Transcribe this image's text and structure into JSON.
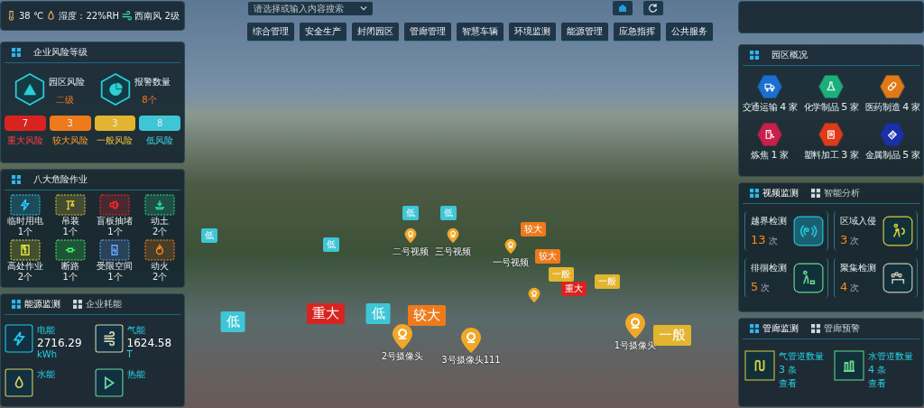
{
  "weather": [
    {
      "kind": "temperature",
      "text": "38 ℃"
    },
    {
      "kind": "humidity",
      "text": "湿度：22%RH"
    },
    {
      "kind": "wind",
      "text": "西南风 2级"
    }
  ],
  "search": {
    "placeholder": "请选择或输入内容搜索"
  },
  "nav": [
    "综合管理",
    "安全生产",
    "封闭园区",
    "管廊管理",
    "智慧车辆",
    "环境监测",
    "能源管理",
    "应急指挥",
    "公共服务"
  ],
  "risk_panel": {
    "title": "企业风险等级",
    "stats": [
      {
        "kind": "risk",
        "label": "园区风险",
        "value": "二级"
      },
      {
        "kind": "alarm",
        "label": "报警数量",
        "value": "8个"
      }
    ],
    "levels": [
      {
        "kind": "major",
        "count": "7",
        "label": "重大风险"
      },
      {
        "kind": "large",
        "count": "3",
        "label": "较大风险"
      },
      {
        "kind": "general",
        "count": "3",
        "label": "一般风险"
      },
      {
        "kind": "low",
        "count": "8",
        "label": "低风险"
      }
    ]
  },
  "hazard_panel": {
    "title": "八大危险作业",
    "items": [
      {
        "kind": "power",
        "label": "临时用电",
        "count": "1个"
      },
      {
        "kind": "crane",
        "label": "吊装",
        "count": "1个"
      },
      {
        "kind": "blind",
        "label": "盲板抽堵",
        "count": "1个"
      },
      {
        "kind": "earth",
        "label": "动土",
        "count": "2个"
      },
      {
        "kind": "height",
        "label": "高处作业",
        "count": "2个"
      },
      {
        "kind": "road",
        "label": "断路",
        "count": "1个"
      },
      {
        "kind": "confined",
        "label": "受限空间",
        "count": "1个"
      },
      {
        "kind": "fire",
        "label": "动火",
        "count": "2个"
      }
    ]
  },
  "energy_panel": {
    "tabs": [
      {
        "label": "能源监测",
        "selected": true
      },
      {
        "label": "企业耗能",
        "selected": false
      }
    ],
    "cards": [
      {
        "kind": "electric",
        "label": "电能",
        "value": "2716.29",
        "unit": "kWh"
      },
      {
        "kind": "gas",
        "label": "气能",
        "value": "1624.58",
        "unit": "T"
      },
      {
        "kind": "water",
        "label": "水能"
      },
      {
        "kind": "heat",
        "label": "热能"
      }
    ]
  },
  "park_panel": {
    "title": "园区概况",
    "items": [
      {
        "kind": "transport",
        "label": "交通运输",
        "count": "4",
        "unit": "家"
      },
      {
        "kind": "chemical",
        "label": "化学制品",
        "count": "5",
        "unit": "家"
      },
      {
        "kind": "medicine",
        "label": "医药制造",
        "count": "4",
        "unit": "家"
      },
      {
        "kind": "coking",
        "label": "炼焦",
        "count": "1",
        "unit": "家"
      },
      {
        "kind": "plastic",
        "label": "塑料加工",
        "count": "3",
        "unit": "家"
      },
      {
        "kind": "metal",
        "label": "金属制品",
        "count": "5",
        "unit": "家"
      }
    ]
  },
  "video_panel": {
    "tabs": [
      {
        "label": "视频监测",
        "selected": true
      },
      {
        "label": "智能分析",
        "selected": false
      }
    ],
    "items": [
      {
        "kind": "boundary",
        "label": "越界检测",
        "count": "13",
        "unit": "次"
      },
      {
        "kind": "intrusion",
        "label": "区域入侵",
        "count": "3",
        "unit": "次"
      },
      {
        "kind": "loiter",
        "label": "徘徊检测",
        "count": "5",
        "unit": "次"
      },
      {
        "kind": "gather",
        "label": "聚集检测",
        "count": "4",
        "unit": "次"
      }
    ]
  },
  "pipe_panel": {
    "tabs": [
      {
        "label": "管廊监测",
        "selected": true
      },
      {
        "label": "管廊预警",
        "selected": false
      }
    ],
    "items": [
      {
        "kind": "gas",
        "label": "气管道数量",
        "count": "3",
        "unit": "条",
        "link": "查看"
      },
      {
        "kind": "water",
        "label": "水管道数量",
        "count": "4",
        "unit": "条",
        "link": "查看"
      }
    ]
  },
  "map": {
    "risk_tags": [
      {
        "kind": "low",
        "text": "低"
      },
      {
        "kind": "low",
        "text": "低"
      },
      {
        "kind": "low",
        "text": "低"
      },
      {
        "kind": "low",
        "text": "低"
      },
      {
        "kind": "large",
        "text": "较大"
      },
      {
        "kind": "large",
        "text": "较大"
      },
      {
        "kind": "general",
        "text": "一般"
      },
      {
        "kind": "major",
        "text": "重大"
      },
      {
        "kind": "general",
        "text": "一般"
      },
      {
        "kind": "low",
        "text": "低"
      },
      {
        "kind": "major",
        "text": "重大"
      },
      {
        "kind": "low",
        "text": "低"
      },
      {
        "kind": "large",
        "text": "较大"
      },
      {
        "kind": "general",
        "text": "一般"
      }
    ],
    "cameras": [
      {
        "label": "二号视频"
      },
      {
        "label": "三号视频"
      },
      {
        "label": "一号视频"
      },
      {
        "label": "2号摄像头"
      },
      {
        "label": "3号摄像头111"
      },
      {
        "label": "1号摄像头"
      },
      {
        "kind": "camera"
      }
    ]
  }
}
